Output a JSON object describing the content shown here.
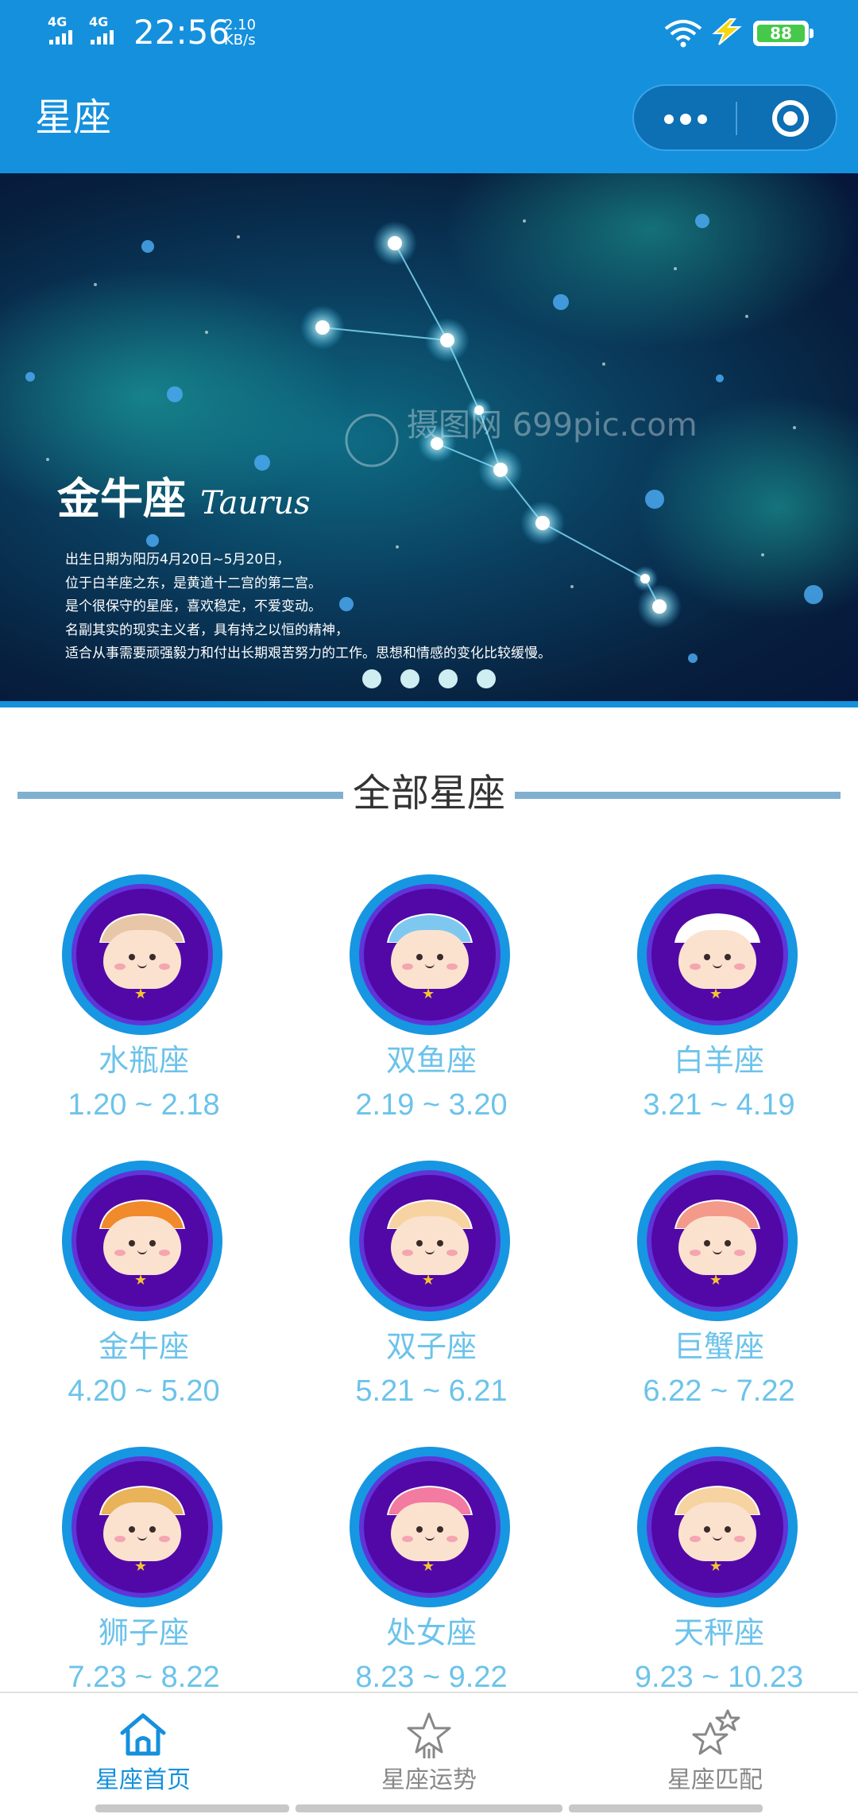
{
  "status_bar": {
    "signal1_label": "4G",
    "signal2_label": "4G",
    "time": "22:56",
    "speed_value": "2.10",
    "speed_unit": "KB/s",
    "battery": "88",
    "icons": [
      "signal-icon",
      "wifi-icon",
      "charging-bolt-icon",
      "battery-icon"
    ]
  },
  "nav": {
    "title": "星座",
    "capsule_icons": [
      "more-dots-icon",
      "close-target-icon"
    ]
  },
  "banner": {
    "title": "金牛座",
    "latin": "Taurus",
    "description": [
      "出生日期为阳历4月20日~5月20日，",
      "位于白羊座之东，是黄道十二宫的第二宫。",
      "是个很保守的星座，喜欢稳定，不爱变动。",
      "名副其实的现实主义者，具有持之以恒的精神，",
      "适合从事需要顽强毅力和付出长期艰苦努力的工作。思想和情感的变化比较缓慢。"
    ],
    "watermark": "摄图网 699pic.com",
    "dots_count": 4,
    "active_dot": 0
  },
  "section": {
    "title": "全部星座"
  },
  "zodiac": [
    {
      "name": "水瓶座",
      "date": "1.20 ~ 2.18",
      "hair": "#e8c7a8"
    },
    {
      "name": "双鱼座",
      "date": "2.19 ~ 3.20",
      "hair": "#7ec8f0"
    },
    {
      "name": "白羊座",
      "date": "3.21 ~ 4.19",
      "hair": "#ffffff"
    },
    {
      "name": "金牛座",
      "date": "4.20 ~ 5.20",
      "hair": "#f08a2a"
    },
    {
      "name": "双子座",
      "date": "5.21 ~ 6.21",
      "hair": "#f6d3a0"
    },
    {
      "name": "巨蟹座",
      "date": "6.22 ~ 7.22",
      "hair": "#f49a8a"
    },
    {
      "name": "狮子座",
      "date": "7.23 ~ 8.22",
      "hair": "#e9b35a"
    },
    {
      "name": "处女座",
      "date": "8.23 ~ 9.22",
      "hair": "#f37aa0"
    },
    {
      "name": "天秤座",
      "date": "9.23 ~ 10.23",
      "hair": "#f6d3a0"
    }
  ],
  "tabs": [
    {
      "label": "星座首页",
      "icon": "home-icon",
      "active": true
    },
    {
      "label": "星座运势",
      "icon": "star-fortune-icon",
      "active": false
    },
    {
      "label": "星座匹配",
      "icon": "star-match-icon",
      "active": false
    }
  ],
  "colors": {
    "primary": "#1590dd",
    "zodiac_text": "#6cc3ea",
    "section_line": "#7fb0d0",
    "avatar_bg": "#5208a6"
  }
}
